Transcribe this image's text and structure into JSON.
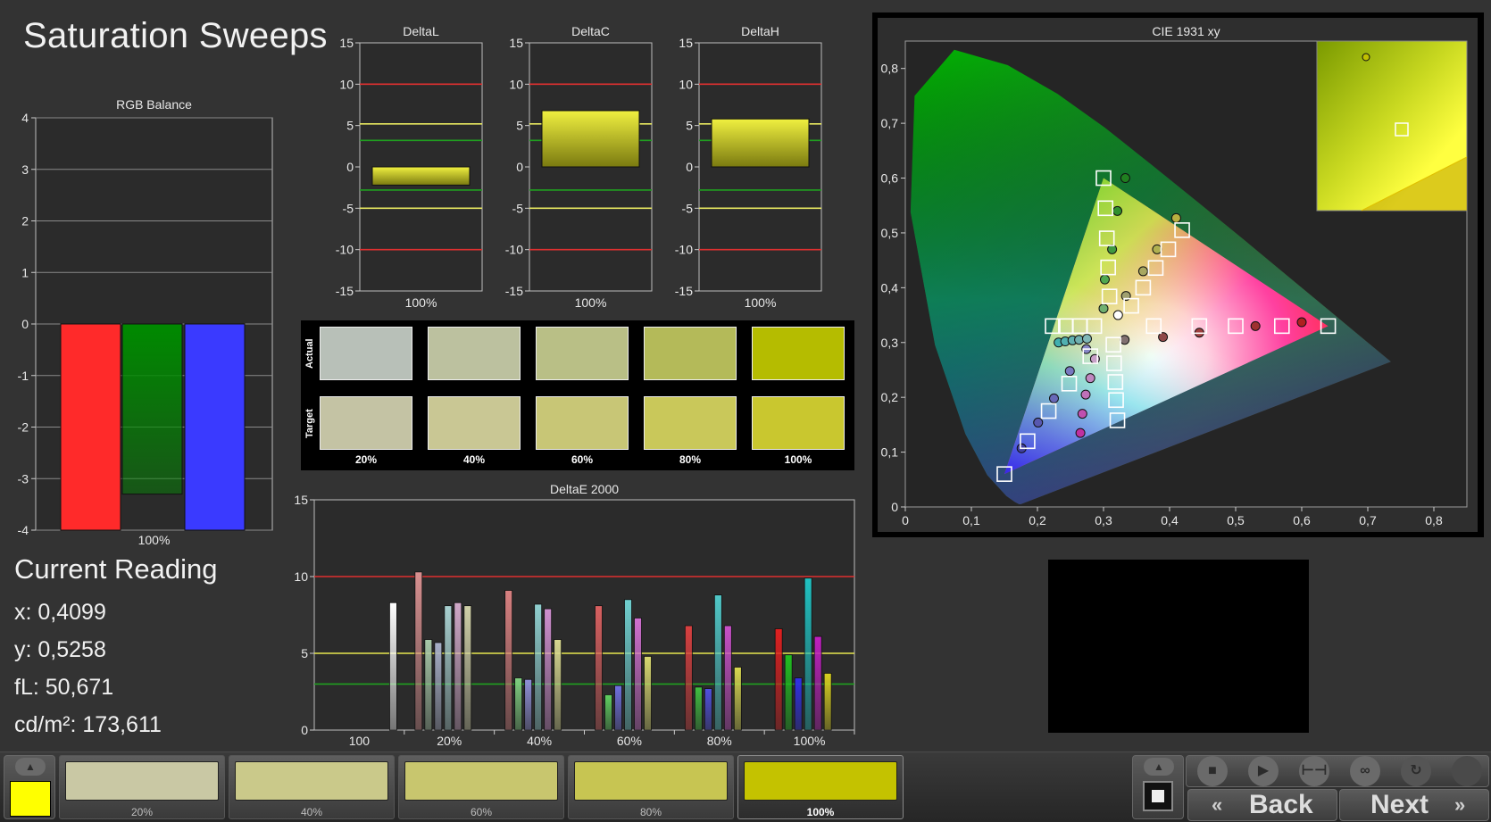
{
  "page_title": "Saturation Sweeps",
  "rgb_balance": {
    "title": "RGB Balance",
    "y_ticks": [
      "4",
      "3",
      "2",
      "1",
      "0",
      "-1",
      "-2",
      "-3",
      "-4"
    ],
    "x_label": "100%",
    "ylim": [
      -4,
      4
    ],
    "bars": [
      {
        "name": "Red",
        "value": -4.0,
        "color": "#ff2a2a"
      },
      {
        "name": "Green",
        "value": -3.3,
        "color": "#008a00"
      },
      {
        "name": "Blue",
        "value": -4.0,
        "color": "#3a3aff"
      }
    ]
  },
  "delta_charts": [
    {
      "title": "DeltaL",
      "x_label": "100%",
      "value": -2.2,
      "ylim": [
        -15,
        15
      ]
    },
    {
      "title": "DeltaC",
      "x_label": "100%",
      "value": 6.8,
      "ylim": [
        -15,
        15
      ]
    },
    {
      "title": "DeltaH",
      "x_label": "100%",
      "value": 5.8,
      "ylim": [
        -15,
        15
      ]
    }
  ],
  "delta_y_ticks": [
    "15",
    "10",
    "5",
    "0",
    "-5",
    "-10",
    "-15"
  ],
  "swatches": {
    "actual_label": "Actual",
    "target_label": "Target",
    "labels": [
      "20%",
      "40%",
      "60%",
      "80%",
      "100%"
    ],
    "actual_colors": [
      "#b8c0b8",
      "#bcc19f",
      "#b9bf86",
      "#b4ba59",
      "#b5bc00"
    ],
    "target_colors": [
      "#c4c3a4",
      "#c9c794",
      "#c8c676",
      "#c9c85a",
      "#c9c72f"
    ]
  },
  "current_reading": {
    "title": "Current Reading",
    "x": "x: 0,4099",
    "y": "y: 0,5258",
    "fl": "fL: 50,671",
    "cdm2": "cd/m²: 173,611"
  },
  "chart_data": [
    {
      "type": "bar",
      "title": "DeltaE 2000",
      "ylim": [
        0,
        15
      ],
      "y_ticks": [
        "15",
        "10",
        "5",
        "0"
      ],
      "categories": [
        "100",
        "20%",
        "40%",
        "60%",
        "80%",
        "100%"
      ],
      "threshold_lines": [
        {
          "value": 10,
          "color": "#e03030"
        },
        {
          "value": 5,
          "color": "#e8e850"
        },
        {
          "value": 3,
          "color": "#20a020"
        }
      ],
      "groups": [
        {
          "category": "100",
          "values": [
            {
              "v": 8.3,
              "c": "#ffffff"
            }
          ]
        },
        {
          "category": "20%",
          "values": [
            {
              "v": 10.3,
              "c": "#d89090"
            },
            {
              "v": 5.9,
              "c": "#a8c8a8"
            },
            {
              "v": 5.7,
              "c": "#a8b0c8"
            },
            {
              "v": 8.1,
              "c": "#a8d0d0"
            },
            {
              "v": 8.3,
              "c": "#d0a8c8"
            },
            {
              "v": 8.1,
              "c": "#d0d0a8"
            }
          ]
        },
        {
          "category": "40%",
          "values": [
            {
              "v": 9.1,
              "c": "#d88080"
            },
            {
              "v": 3.4,
              "c": "#80d080"
            },
            {
              "v": 3.3,
              "c": "#9090d8"
            },
            {
              "v": 8.2,
              "c": "#90d0d0"
            },
            {
              "v": 7.9,
              "c": "#d090d0"
            },
            {
              "v": 5.9,
              "c": "#d8d890"
            }
          ]
        },
        {
          "category": "60%",
          "values": [
            {
              "v": 8.1,
              "c": "#d86060"
            },
            {
              "v": 2.3,
              "c": "#60d060"
            },
            {
              "v": 2.9,
              "c": "#7070e0"
            },
            {
              "v": 8.5,
              "c": "#70d0d0"
            },
            {
              "v": 7.3,
              "c": "#d070d0"
            },
            {
              "v": 4.8,
              "c": "#d8d870"
            }
          ]
        },
        {
          "category": "80%",
          "values": [
            {
              "v": 6.8,
              "c": "#d84040"
            },
            {
              "v": 2.8,
              "c": "#40c040"
            },
            {
              "v": 2.7,
              "c": "#5050e0"
            },
            {
              "v": 8.8,
              "c": "#50c8c8"
            },
            {
              "v": 6.8,
              "c": "#c850c8"
            },
            {
              "v": 4.1,
              "c": "#d8d850"
            }
          ]
        },
        {
          "category": "100%",
          "values": [
            {
              "v": 6.6,
              "c": "#e02020"
            },
            {
              "v": 4.9,
              "c": "#20c020"
            },
            {
              "v": 3.4,
              "c": "#3030e8"
            },
            {
              "v": 9.9,
              "c": "#20c0c0"
            },
            {
              "v": 6.1,
              "c": "#c020c0"
            },
            {
              "v": 3.7,
              "c": "#d8d020"
            }
          ]
        }
      ]
    },
    {
      "type": "scatter",
      "title": "CIE 1931 xy",
      "xlim": [
        0,
        0.85
      ],
      "ylim": [
        0,
        0.85
      ],
      "x_ticks": [
        "0",
        "0,1",
        "0,2",
        "0,3",
        "0,4",
        "0,5",
        "0,6",
        "0,7",
        "0,8"
      ],
      "y_ticks": [
        "0",
        "0,1",
        "0,2",
        "0,3",
        "0,4",
        "0,5",
        "0,6",
        "0,7",
        "0,8"
      ],
      "gamut": {
        "red": [
          0.64,
          0.33
        ],
        "green": [
          0.3,
          0.6
        ],
        "blue": [
          0.15,
          0.06
        ]
      },
      "white_point": [
        0.3127,
        0.329
      ],
      "targets": [
        [
          0.64,
          0.33
        ],
        [
          0.57,
          0.33
        ],
        [
          0.5,
          0.33
        ],
        [
          0.445,
          0.33
        ],
        [
          0.376,
          0.33
        ],
        [
          0.3,
          0.6
        ],
        [
          0.303,
          0.545
        ],
        [
          0.305,
          0.49
        ],
        [
          0.307,
          0.437
        ],
        [
          0.309,
          0.384
        ],
        [
          0.419,
          0.505
        ],
        [
          0.398,
          0.47
        ],
        [
          0.379,
          0.436
        ],
        [
          0.36,
          0.4
        ],
        [
          0.342,
          0.367
        ],
        [
          0.223,
          0.33
        ],
        [
          0.243,
          0.33
        ],
        [
          0.264,
          0.33
        ],
        [
          0.286,
          0.33
        ],
        [
          0.15,
          0.06
        ],
        [
          0.185,
          0.12
        ],
        [
          0.217,
          0.175
        ],
        [
          0.248,
          0.225
        ],
        [
          0.28,
          0.275
        ],
        [
          0.321,
          0.158
        ],
        [
          0.319,
          0.195
        ],
        [
          0.318,
          0.228
        ],
        [
          0.316,
          0.262
        ],
        [
          0.315,
          0.296
        ]
      ],
      "measured": [
        {
          "x": 0.6,
          "y": 0.337,
          "c": "#b02020"
        },
        {
          "x": 0.53,
          "y": 0.33,
          "c": "#a03030"
        },
        {
          "x": 0.445,
          "y": 0.318,
          "c": "#a04040"
        },
        {
          "x": 0.39,
          "y": 0.31,
          "c": "#904848"
        },
        {
          "x": 0.332,
          "y": 0.305,
          "c": "#807070"
        },
        {
          "x": 0.333,
          "y": 0.6,
          "c": "#208020"
        },
        {
          "x": 0.321,
          "y": 0.54,
          "c": "#30902e"
        },
        {
          "x": 0.313,
          "y": 0.47,
          "c": "#409a40"
        },
        {
          "x": 0.302,
          "y": 0.415,
          "c": "#50a850"
        },
        {
          "x": 0.3,
          "y": 0.362,
          "c": "#70b070"
        },
        {
          "x": 0.41,
          "y": 0.527,
          "c": "#b8b040"
        },
        {
          "x": 0.381,
          "y": 0.47,
          "c": "#b0b050"
        },
        {
          "x": 0.36,
          "y": 0.43,
          "c": "#a8a860"
        },
        {
          "x": 0.334,
          "y": 0.385,
          "c": "#a0a070"
        },
        {
          "x": 0.232,
          "y": 0.3,
          "c": "#40b0b0"
        },
        {
          "x": 0.242,
          "y": 0.302,
          "c": "#50b0b0"
        },
        {
          "x": 0.253,
          "y": 0.304,
          "c": "#60b0b0"
        },
        {
          "x": 0.263,
          "y": 0.305,
          "c": "#70b0b0"
        },
        {
          "x": 0.275,
          "y": 0.307,
          "c": "#80b8b8"
        },
        {
          "x": 0.176,
          "y": 0.107,
          "c": "#4040a0"
        },
        {
          "x": 0.201,
          "y": 0.154,
          "c": "#5858b0"
        },
        {
          "x": 0.225,
          "y": 0.198,
          "c": "#6868b8"
        },
        {
          "x": 0.249,
          "y": 0.248,
          "c": "#7878c0"
        },
        {
          "x": 0.274,
          "y": 0.288,
          "c": "#8888c8"
        },
        {
          "x": 0.265,
          "y": 0.135,
          "c": "#c030a0"
        },
        {
          "x": 0.268,
          "y": 0.17,
          "c": "#c050b0"
        },
        {
          "x": 0.273,
          "y": 0.205,
          "c": "#c070b8"
        },
        {
          "x": 0.28,
          "y": 0.235,
          "c": "#c088c0"
        },
        {
          "x": 0.287,
          "y": 0.27,
          "c": "#c8a0c8"
        },
        {
          "x": 0.322,
          "y": 0.35,
          "c": "#ffffff"
        }
      ],
      "zoom_inset": {
        "measured": [
          0.4099,
          0.5258
        ],
        "target": [
          0.419,
          0.505
        ]
      }
    }
  ],
  "toolbar": {
    "step_labels": [
      "20%",
      "40%",
      "60%",
      "80%",
      "100%"
    ],
    "step_colors": [
      "#c9c8a4",
      "#cac98a",
      "#c8c66e",
      "#c7c552",
      "#c4c200"
    ],
    "active_index": 4,
    "current_color": "#ffff00",
    "back_label": "Back",
    "next_label": "Next",
    "icons": [
      "up-arrow-icon",
      "stop-icon",
      "play-icon",
      "fit-icon",
      "loop-icon",
      "refresh-icon",
      "record-icon"
    ]
  }
}
